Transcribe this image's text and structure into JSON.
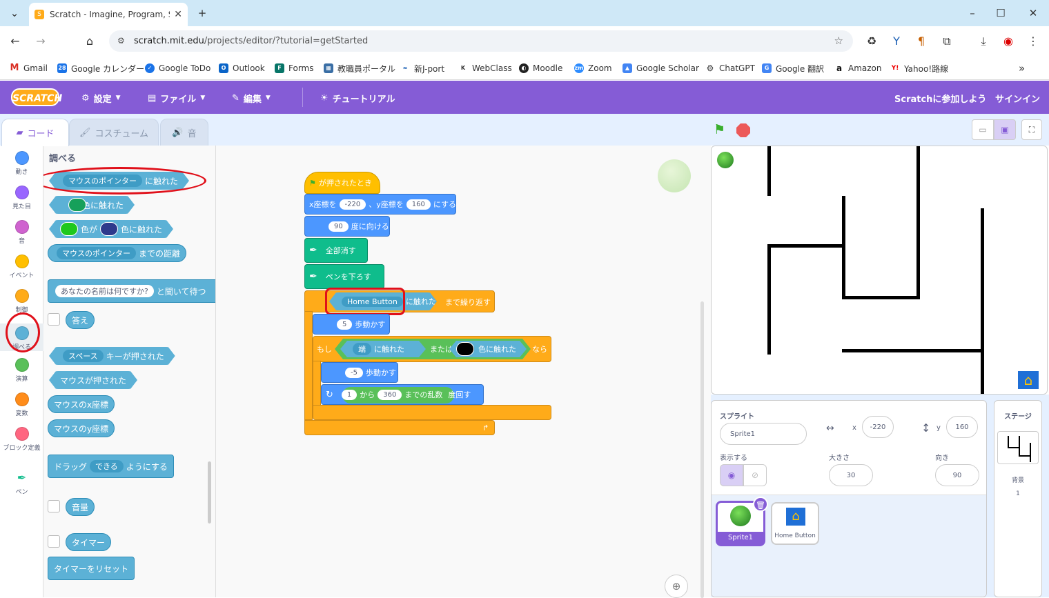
{
  "browser": {
    "tab_title": "Scratch - Imagine, Program, Sh",
    "url_host": "scratch.mit.edu",
    "url_path": "/projects/editor/?tutorial=getStarted",
    "bookmarks": [
      "Gmail",
      "Google カレンダー",
      "Google ToDo",
      "Outlook",
      "Forms",
      "教職員ポータル",
      "新J-port",
      "WebClass",
      "Moodle",
      "Zoom",
      "Google Scholar",
      "ChatGPT",
      "Google 翻訳",
      "Amazon",
      "Yahoo!路線"
    ]
  },
  "header": {
    "logo": "SCRATCH",
    "settings": "設定",
    "file": "ファイル",
    "edit": "編集",
    "tutorial": "チュートリアル",
    "join": "Scratchに参加しよう",
    "signin": "サインイン"
  },
  "editor_tabs": {
    "code": "コード",
    "costume": "コスチューム",
    "sound": "音"
  },
  "categories": [
    "動き",
    "見た目",
    "音",
    "イベント",
    "制御",
    "調べる",
    "演算",
    "変数",
    "ブロック定義",
    "ペン"
  ],
  "category_colors": [
    "#4c97ff",
    "#9966ff",
    "#cf63cf",
    "#ffbf00",
    "#ffab19",
    "#5cb1d6",
    "#59c059",
    "#ff8c1a",
    "#ff6680",
    "#0fbd8c"
  ],
  "palette": {
    "heading": "調べる",
    "b1_slot": "マウスのポインター",
    "b1_text": "に触れた",
    "b2_text": "色に触れた",
    "b3_mid": "色が",
    "b3_text": "色に触れた",
    "b4_slot": "マウスのポインター",
    "b4_text": "までの距離",
    "b5_slot": "あなたの名前は何ですか?",
    "b5_text": "と聞いて待つ",
    "answer": "答え",
    "b6_slot": "スペース",
    "b6_text": "キーが押された",
    "mouse_down": "マウスが押された",
    "mouse_x": "マウスのx座標",
    "mouse_y": "マウスのy座標",
    "drag_pre": "ドラッグ",
    "drag_slot": "できる",
    "drag_post": "ようにする",
    "loudness": "音量",
    "timer": "タイマー",
    "reset_timer": "タイマーをリセット"
  },
  "script": {
    "hat": "が押されたとき",
    "goto_x_label": "x座標を",
    "goto_x": "-220",
    "goto_y_label": "、y座標を",
    "goto_y": "160",
    "goto_end": "にする",
    "point_val": "90",
    "point_label": "度に向ける",
    "clear": "全部消す",
    "pendown": "ペンを下ろす",
    "until_slot": "Home Button",
    "until_touch": "に触れた",
    "until_label": "まで繰り返す",
    "move1_val": "5",
    "move1_label": "歩動かす",
    "if_label": "もし",
    "if_edge": "端",
    "if_touch": "に触れた",
    "if_or": "または",
    "if_color": "色に触れた",
    "if_then": "なら",
    "move2_val": "-5",
    "move2_label": "歩動かす",
    "turn_from": "1",
    "turn_kara": "から",
    "turn_to": "360",
    "turn_rand": "までの乱数",
    "turn_label": "度回す"
  },
  "sprite_info": {
    "sprite_label": "スプライト",
    "name": "Sprite1",
    "x_label": "x",
    "x": "-220",
    "y_label": "y",
    "y": "160",
    "show_label": "表示する",
    "size_label": "大きさ",
    "size": "30",
    "dir_label": "向き",
    "dir": "90"
  },
  "sprites": [
    {
      "name": "Sprite1"
    },
    {
      "name": "Home Button"
    }
  ],
  "stage_panel": {
    "title": "ステージ",
    "backdrop_label": "背景",
    "backdrop_count": "1"
  }
}
